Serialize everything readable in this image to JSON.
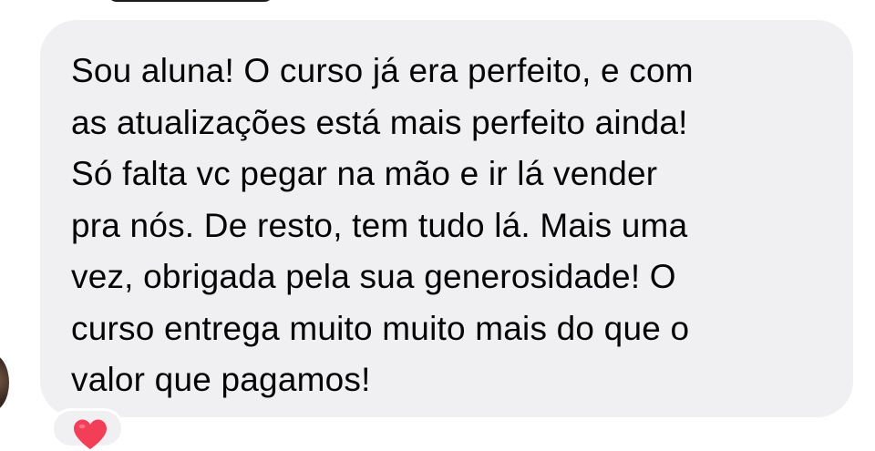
{
  "comment": {
    "text": "Sou aluna! O curso já era perfeito, e com\nas atualizações está mais perfeito ainda!\nSó falta vc pegar na mão e ir lá vender\npra nós. De resto, tem tudo lá. Mais uma\nvez, obrigada pela sua generosidade! O\ncurso entrega muito muito mais do que o\nvalor que pagamos!"
  },
  "reaction": {
    "icon": "heart-icon",
    "color": "#f33e58"
  },
  "colors": {
    "bubble": "#f0f0f2",
    "text": "#050505"
  }
}
